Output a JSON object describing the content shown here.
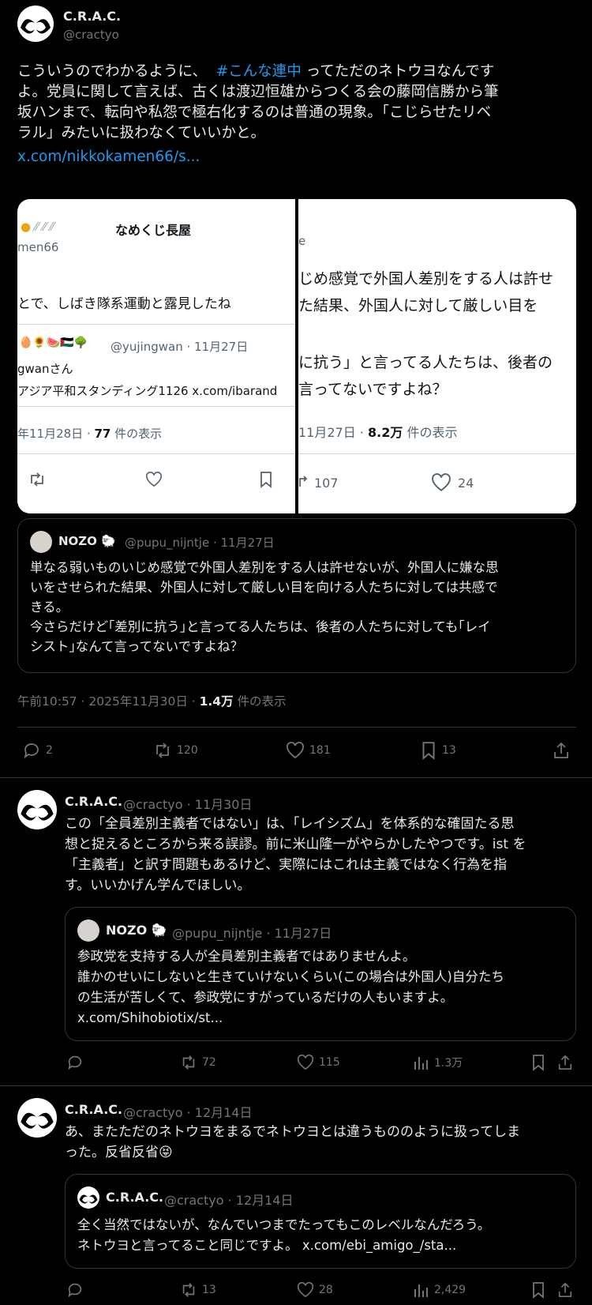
{
  "main_tweet": {
    "author_name": "C.R.A.C.",
    "author_handle": "@cractyo",
    "text_line1_pre": "こういうのでわかるように、",
    "hashtag": "#こんな連中",
    "text_line1_post": "ってただのネトウヨなんです",
    "text_line2": "よ。党員に関して言えば、古くは渡辺恒雄からつくる会の藤岡信勝から筆",
    "text_line3": "坂ハンまで、転向や私怨で極右化するのは普通の現象。「こじらせたリベ",
    "text_line4": "ラル」みたいに扱わなくていいかと。",
    "link": "x.com/nikkokamen66/s...",
    "timestamp": "午前10:57 · 2025年11月30日 · ",
    "views_count": "1.4万",
    "views_label": "件の表示",
    "replies": "2",
    "retweets": "120",
    "likes": "181",
    "bookmarks": "13"
  },
  "image_left": {
    "name": "なめくじ長屋",
    "handle": "men66",
    "text": "とで、しばき隊系運動と露見したね",
    "quoted_handle": "@yujingwan · 11月27日",
    "quoted_name": "gwanさん",
    "quoted_text": "アジア平和スタンディング1126 x.com/ibarand",
    "date": "年11月28日 · ",
    "views": "77",
    "views_label": "件の表示"
  },
  "image_right": {
    "handle": "e",
    "line1": "じめ感覚で外国人差別をする人は許せ",
    "line2": "た結果、外国人に対して厳しい目を",
    "line3": "に抗う」と言ってる人たちは、後者の",
    "line4": "言ってないですよね？",
    "date": "11月27日 · ",
    "views": "8.2万",
    "views_label": "件の表示",
    "retweets": "107",
    "likes": "24"
  },
  "quote1": {
    "name": "NOZO",
    "handle_date": "@pupu_nijntje · 11月27日",
    "line1": "単なる弱いものいじめ感覚で外国人差別をする人は許せないが、外国人に嫌な思",
    "line2": "いをさせられた結果、外国人に対して厳しい目を向ける人たちに対しては共感で",
    "line3": "きる。",
    "line4": "今さらだけど｢差別に抗う｣と言ってる人たちは、後者の人たちに対しても｢レイ",
    "line5": "シスト｣なんて言ってないですよね？"
  },
  "reply1": {
    "author_name": "C.R.A.C.",
    "handle_date": "@cractyo · 11月30日",
    "line1": "この「全員差別主義者ではない」は、「レイシズム」を体系的な確固たる思",
    "line2": "想と捉えるところから来る誤謬。前に米山隆一がやらかしたやつです。ist を",
    "line3": "「主義者」と訳す問題もあるけど、実際にはこれは主義ではなく行為を指",
    "line4": "す。いいかげん学んでほしい。",
    "quote_name": "NOZO",
    "quote_handle_date": "@pupu_nijntje · 11月27日",
    "quote_line1": "参政党を支持する人が全員差別主義者ではありませんよ。",
    "quote_line2": "誰かのせいにしないと生きていけないくらい(この場合は外国人)自分たち",
    "quote_line3": "の生活が苦しくて、参政党にすがっているだけの人もいますよ。",
    "quote_link": "x.com/Shihobiotix/st...",
    "retweets": "72",
    "likes": "115",
    "views": "1.3万"
  },
  "reply2": {
    "author_name": "C.R.A.C.",
    "handle_date": "@cractyo · 12月14日",
    "line1": "あ、またただのネトウヨをまるでネトウヨとは違うもののように扱ってしま",
    "line2": "った。反省反省😝",
    "quote_name": "C.R.A.C.",
    "quote_handle_date": "@cractyo · 12月14日",
    "quote_line1": "全く当然ではないが、なんでいつまでたってもこのレベルなんだろう。",
    "quote_line2": "ネトウヨと言ってること同じですよ。 x.com/ebi_amigo_/sta...",
    "retweets": "13",
    "likes": "28",
    "views": "2,429"
  },
  "colors": {
    "background": "#000000",
    "accent": "#1d9bf0",
    "muted": "#71767b",
    "border": "#2f3336"
  }
}
